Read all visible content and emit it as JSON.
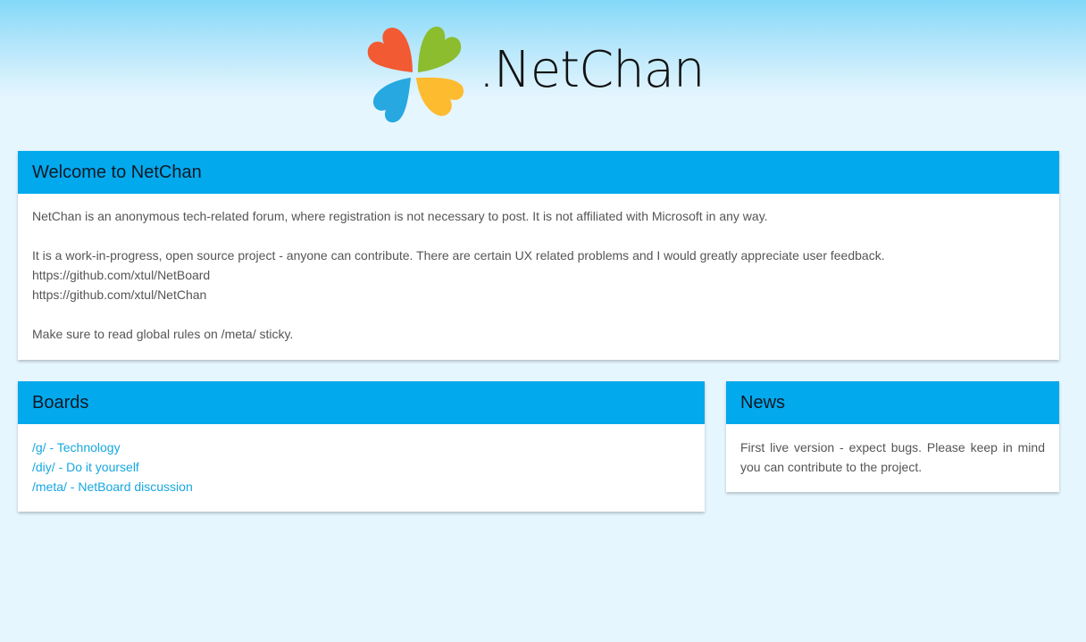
{
  "site": {
    "logo_text": ".NetChan",
    "colors": {
      "accent": "#03a9ed",
      "background": "#e6f6fe",
      "link": "#16a7e0",
      "petal_red": "#f25a33",
      "petal_green": "#8cbd2f",
      "petal_blue": "#27a8e0",
      "petal_yellow": "#fdbb30"
    },
    "logo_icon": "four-petal-clover-icon"
  },
  "welcome": {
    "title": "Welcome to NetChan",
    "line1": "NetChan is an anonymous tech-related forum, where registration is not necessary to post. It is not affiliated with Microsoft in any way.",
    "line2": "It is a work-in-progress, open source project - anyone can contribute. There are certain UX related problems and I would greatly appreciate user feedback.",
    "link1": "https://github.com/xtul/NetBoard",
    "link2": "https://github.com/xtul/NetChan",
    "line3": "Make sure to read global rules on /meta/ sticky."
  },
  "boards": {
    "title": "Boards",
    "items": [
      {
        "label": "/g/ - Technology"
      },
      {
        "label": "/diy/ - Do it yourself"
      },
      {
        "label": "/meta/ - NetBoard discussion"
      }
    ]
  },
  "news": {
    "title": "News",
    "text": "First live version - expect bugs. Please keep in mind you can contribute to the project."
  }
}
